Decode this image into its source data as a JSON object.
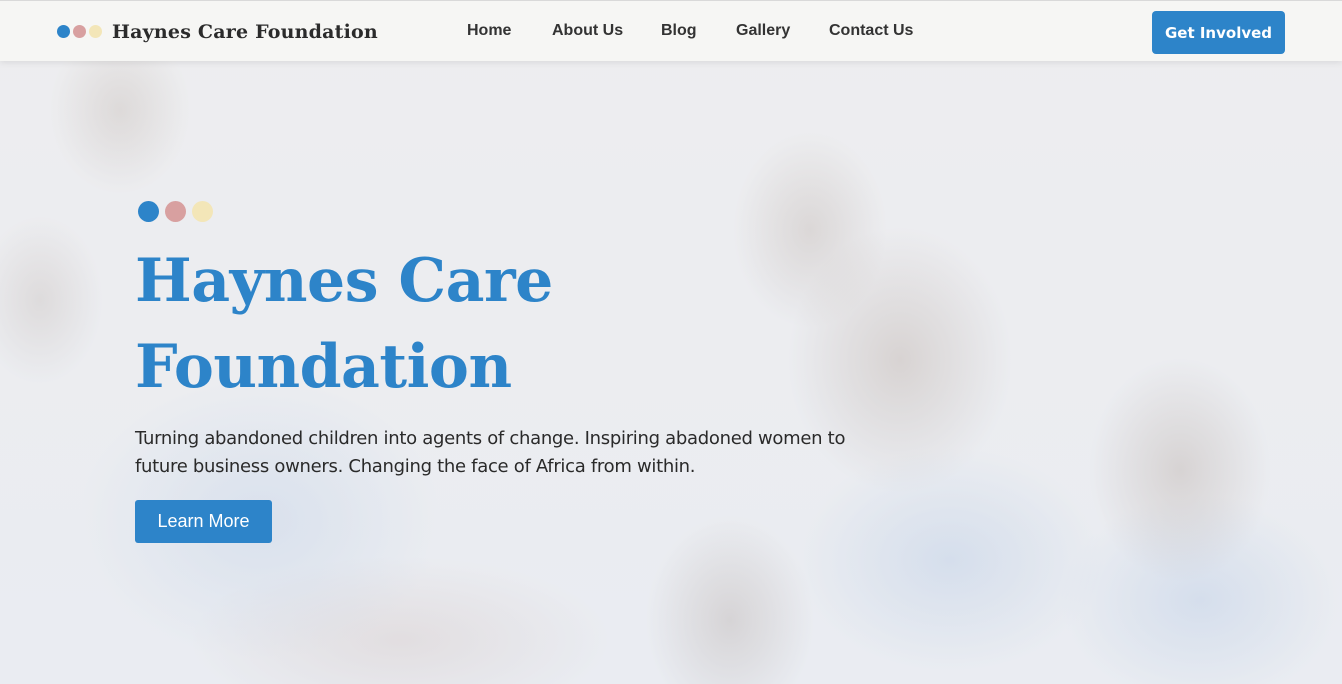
{
  "colors": {
    "accent": "#2d84c9",
    "dot_blue": "#2d84c9",
    "dot_pink": "#d8a0a0",
    "dot_cream": "#f3e6b8"
  },
  "header": {
    "brand": "Haynes Care Foundation",
    "nav": [
      "Home",
      "About Us",
      "Blog",
      "Gallery",
      "Contact Us"
    ],
    "cta": "Get Involved"
  },
  "hero": {
    "title_line1": "Haynes Care",
    "title_line2": "Foundation",
    "subtitle": "Turning abandoned children into agents of change. Inspiring abadoned women to future business owners. Changing the face of Africa from within.",
    "button": "Learn More"
  }
}
